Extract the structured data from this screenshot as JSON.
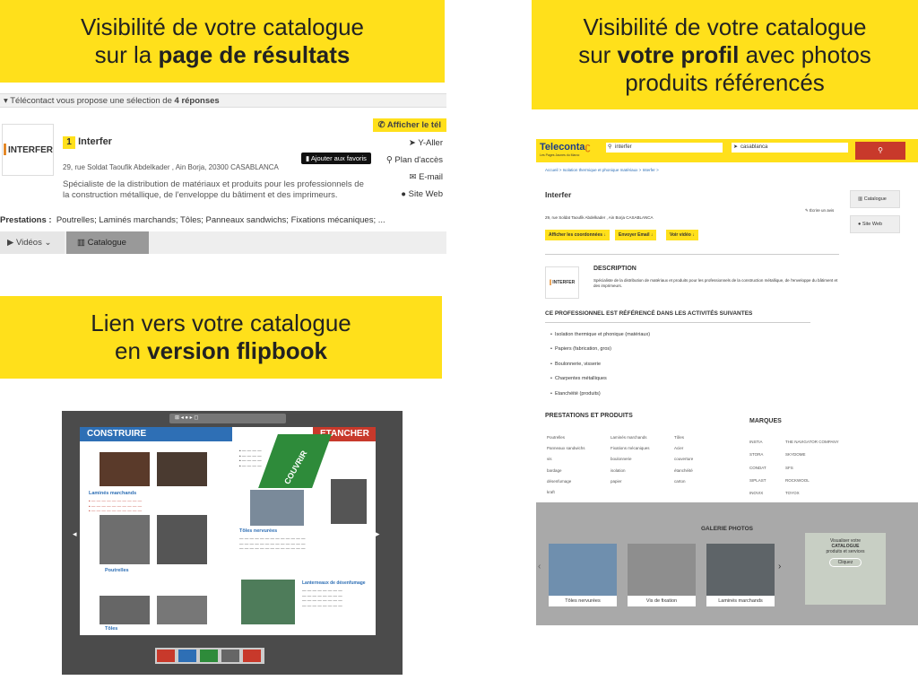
{
  "boxes": {
    "results": {
      "line1": "Visibilité de votre catalogue",
      "line2_pre": "sur la ",
      "line2_bold": "page de résultats"
    },
    "profile": {
      "line1": "Visibilité de votre catalogue",
      "line2_pre": "sur ",
      "line2_bold": "votre profil",
      "line2_post": " avec photos",
      "line3": "produits référencés"
    },
    "flipbook": {
      "line1": "Lien vers votre catalogue",
      "line2_pre": "en ",
      "line2_bold": "version flipbook"
    }
  },
  "results": {
    "header_pre": "Télécontact vous propose une sélection de ",
    "header_bold": "4 réponses",
    "logo_text": "INTERFER",
    "rank": "1",
    "name": "Interfer",
    "address": "29, rue Soldat Taoufik Abdelkader , Ain Borja, 20300 CASABLANCA",
    "description": "Spécialiste de la distribution de matériaux et produits pour les professionnels de la construction métallique, de l'enveloppe du bâtiment et des imprimeurs.",
    "favorite": "Ajouter aux favoris",
    "show_phone": "Afficher le tél",
    "actions": [
      "Y-Aller",
      "Plan d'accès",
      "E-mail",
      "Site Web"
    ],
    "prestations_label": "Prestations :",
    "prestations": "Poutrelles;  Laminés marchands;  Tôles;  Panneaux sandwichs;  Fixations mécaniques;  ...",
    "tab_videos": "Vidéos",
    "tab_catalogue": "Catalogue"
  },
  "flipbook": {
    "left_header": "CONSTRUIRE",
    "right_header": "ETANCHER",
    "ribbon": "COUVRIR",
    "sections_left": [
      "Laminés marchands",
      "Poutrelles",
      "Tôles"
    ],
    "sections_right": [
      "Tôles nervurées",
      "Lanterneaux de désenfumage"
    ]
  },
  "profile": {
    "brand": "Teleconta",
    "brand_sub": "Les Pages Jaunes du Maroc",
    "search_value": "interfer",
    "location_value": "casablanca",
    "breadcrumb": "Accueil > Isolation thermique et phonique matériaux > Interfer >",
    "name": "Interfer",
    "review": "Écrire un avis",
    "address": "29, rue Soldat Taoufik Abdelkader , Ain Borja    CASABLANCA",
    "buttons": [
      "Afficher les coordonnées",
      "Envoyer Email",
      "Voir vidéo"
    ],
    "side": [
      "Catalogue",
      "Site Web"
    ],
    "desc_title": "DESCRIPTION",
    "desc_text": "Spécialiste de la distribution de matériaux et produits pour les professionnels de la construction métallique, de l'enveloppe du bâtiment et des imprimeurs.",
    "activities_title": "CE PROFESSIONNEL EST RÉFÉRENCÉ DANS LES ACTIVITÉS SUIVANTES",
    "activities": [
      "Isolation thermique et phonique (matériaux)",
      "Papiers (fabrication, gros)",
      "Boulonnerie, visserie",
      "Charpentes métalliques",
      "Etanchéité (produits)"
    ],
    "prest_title": "PRESTATIONS ET PRODUITS",
    "prest": [
      [
        "Poutrelles",
        "Laminés marchands",
        "Tôles"
      ],
      [
        "Panneaux sandwichs",
        "Fixations mécaniques",
        "Acier"
      ],
      [
        "vis",
        "boulonnerie",
        "couverture"
      ],
      [
        "bardage",
        "isolation",
        "étanchéité"
      ],
      [
        "désenfumage",
        "papier",
        "carton"
      ],
      [
        "kraft",
        "",
        ""
      ]
    ],
    "brands_title": "MARQUES",
    "brands": [
      [
        "INSTIA",
        "THE NAVIGATOR COMPANY"
      ],
      [
        "STORA",
        "SKYDOME"
      ],
      [
        "CONDAT",
        "SFS"
      ],
      [
        "SIPLAST",
        "ROCKWOOL"
      ],
      [
        "INOVIX",
        "TOYOX"
      ]
    ],
    "gallery_title": "GALERIE PHOTOS",
    "gallery": [
      "Tôles nervurées",
      "Vis de fixation",
      "Laminés marchands"
    ],
    "cta_line1": "Visualiser votre",
    "cta_line2": "CATALOGUE",
    "cta_line3": "produits et services",
    "cta_button": "Cliquez"
  },
  "colors": {
    "yellow": "#ffe01b",
    "blue": "#2e6fb5",
    "green": "#2e8b3a",
    "red": "#c8392b"
  }
}
